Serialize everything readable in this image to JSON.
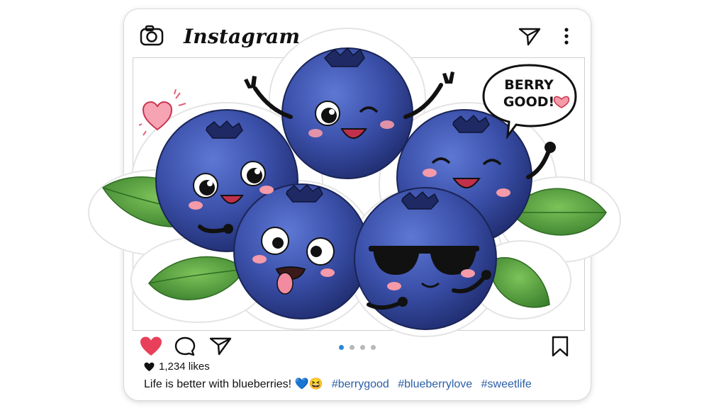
{
  "app": {
    "brand": "Instagram"
  },
  "post": {
    "speech_bubble": [
      "BERRY",
      "GOOD!"
    ],
    "likes_text": "1,234 likes",
    "caption": "Life is better with blueberries! 💙😆",
    "hashtags": [
      "#berrygood",
      "#blueberrylove",
      "#sweetlife"
    ],
    "carousel": {
      "count": 4,
      "active_index": 0
    }
  },
  "icons": {
    "camera": "camera-icon",
    "send": "paper-plane-icon",
    "more": "more-vertical-icon",
    "like": "heart-icon",
    "comment": "comment-icon",
    "share": "paper-plane-icon",
    "save": "bookmark-icon"
  },
  "colors": {
    "like": "#e8405a",
    "carousel_active": "#2a88d8",
    "hashtag": "#2a5ea8",
    "berry": "#3a4fa8",
    "leaf": "#4a9a3a"
  }
}
